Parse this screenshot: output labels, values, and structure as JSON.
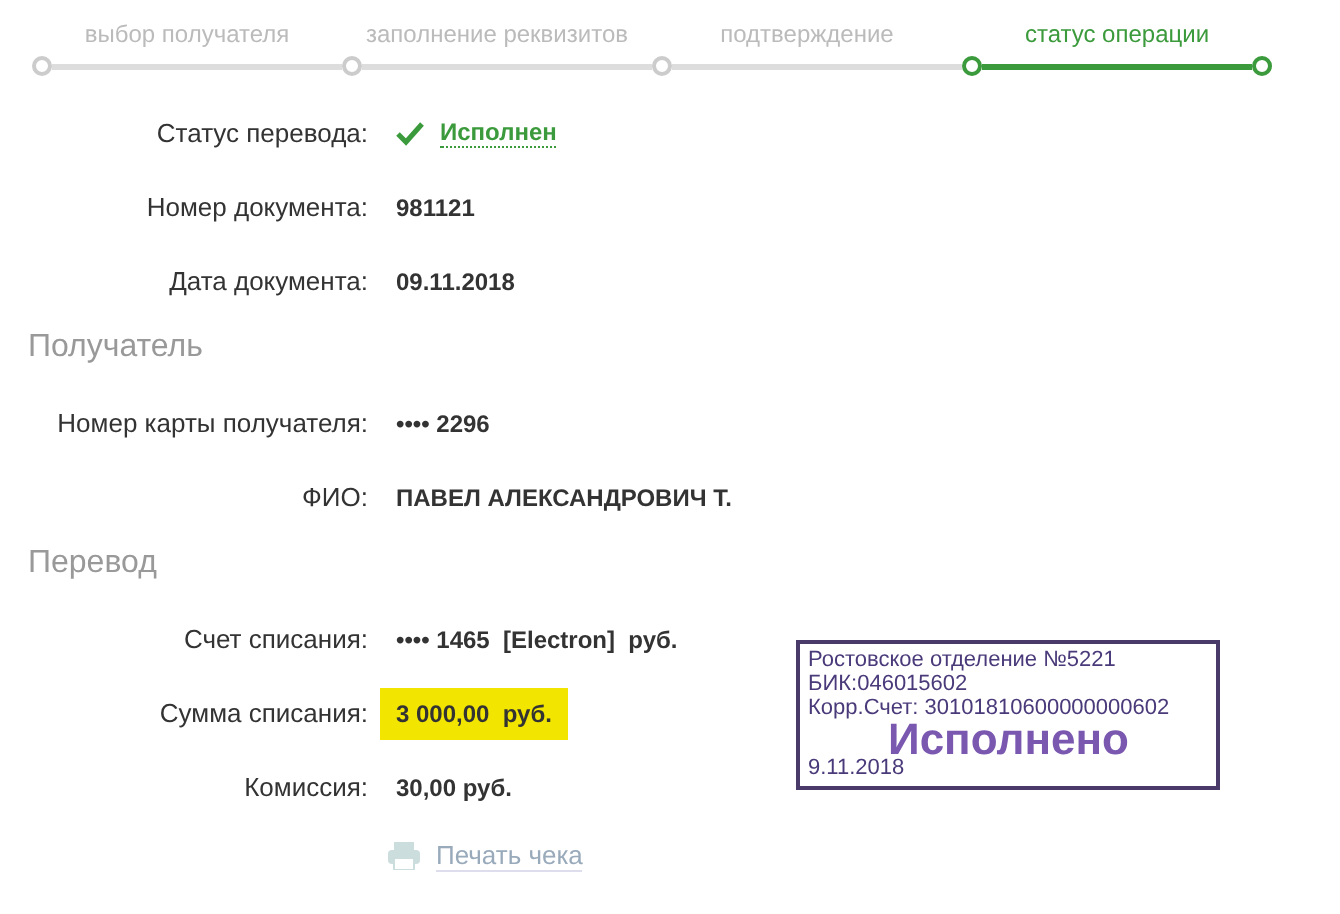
{
  "steps": [
    {
      "label": "выбор получателя",
      "selected": false
    },
    {
      "label": "заполнение реквизитов",
      "selected": false
    },
    {
      "label": "подтверждение",
      "selected": false
    },
    {
      "label": "статус операции",
      "selected": true
    }
  ],
  "sections": [
    {
      "rows": [
        {
          "kind": "status",
          "label": "Статус перевода:",
          "value": "Исполнен"
        },
        {
          "kind": "plain",
          "label": "Номер документа:",
          "value": "981121"
        },
        {
          "kind": "plain",
          "label": "Дата документа:",
          "value": "09.11.2018"
        }
      ]
    },
    {
      "title": "Получатель",
      "rows": [
        {
          "kind": "plain",
          "label": "Номер карты получателя:",
          "value": "•••• 2296"
        },
        {
          "kind": "plain",
          "label": "ФИО:",
          "value": "ПАВЕЛ АЛЕКСАНДРОВИЧ Т."
        }
      ]
    },
    {
      "title": "Перевод",
      "rows": [
        {
          "kind": "plain",
          "label": "Счет списания:",
          "value": "•••• 1465  [Electron]  руб."
        },
        {
          "kind": "highlight",
          "label": "Сумма списания:",
          "value": "3 000,00  руб."
        },
        {
          "kind": "plain",
          "label": "Комиссия:",
          "value": "30,00 руб."
        }
      ]
    }
  ],
  "print_link": "Печать чека",
  "stamp": {
    "lines": [
      "Ростовское отделение №5221",
      "БИК:046015602",
      "Корр.Счет: 30101810600000000602"
    ],
    "status": "Исполнено",
    "date": "9.11.2018"
  }
}
